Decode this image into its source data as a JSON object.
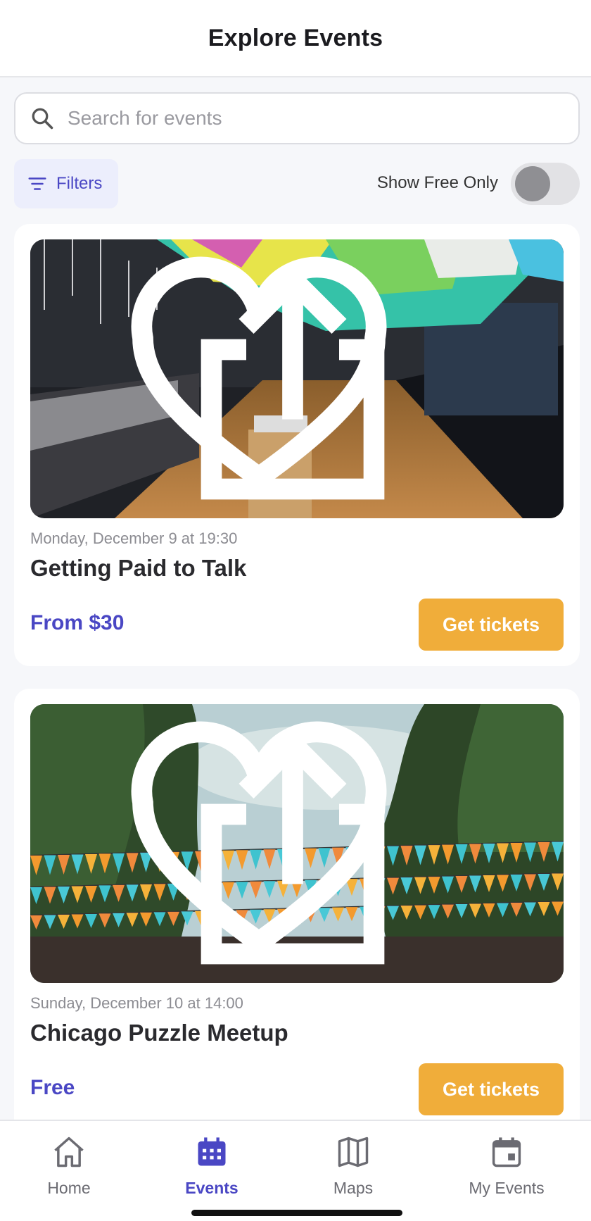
{
  "header": {
    "title": "Explore Events"
  },
  "search": {
    "placeholder": "Search for events",
    "value": ""
  },
  "filters": {
    "label": "Filters"
  },
  "free_toggle": {
    "label": "Show Free Only",
    "on": false
  },
  "events": [
    {
      "date": "Monday, December 9 at 19:30",
      "title": "Getting Paid to Talk",
      "price": "From $30",
      "button": "Get tickets"
    },
    {
      "date": "Sunday, December 10 at 14:00",
      "title": "Chicago Puzzle Meetup",
      "price": "Free",
      "button": "Get tickets"
    }
  ],
  "tabbar": {
    "items": [
      {
        "label": "Home",
        "icon": "home-icon",
        "active": false
      },
      {
        "label": "Events",
        "icon": "calendar-icon",
        "active": true
      },
      {
        "label": "Maps",
        "icon": "map-icon",
        "active": false
      },
      {
        "label": "My Events",
        "icon": "calendar-check-icon",
        "active": false
      }
    ]
  },
  "colors": {
    "accent": "#4a47c4",
    "button": "#f0ad3a",
    "background": "#f6f7fa"
  }
}
